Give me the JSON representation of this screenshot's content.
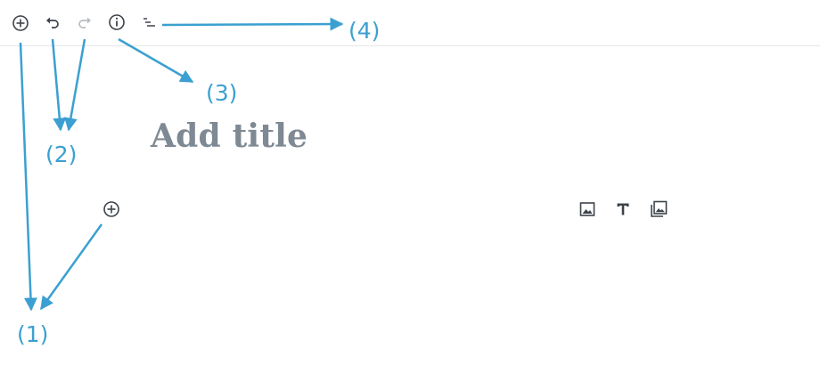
{
  "toolbar": {
    "buttons": [
      {
        "icon": "plus-circle-icon",
        "state": "enabled"
      },
      {
        "icon": "undo-icon",
        "state": "enabled"
      },
      {
        "icon": "redo-icon",
        "state": "disabled"
      },
      {
        "icon": "info-icon",
        "state": "enabled"
      },
      {
        "icon": "list-view-icon",
        "state": "enabled"
      }
    ]
  },
  "editor": {
    "title_placeholder": "Add title"
  },
  "block_toolbar": {
    "buttons": [
      {
        "icon": "image-icon"
      },
      {
        "icon": "text-icon"
      },
      {
        "icon": "gallery-icon"
      }
    ]
  },
  "annotations": {
    "label_1": "(1)",
    "label_2": "(2)",
    "label_3": "(3)",
    "label_4": "(4)",
    "color": "#3ba0d1"
  },
  "colors": {
    "icon": "#3c434a",
    "icon_disabled": "#b8bcc0",
    "placeholder": "#7e8993"
  }
}
